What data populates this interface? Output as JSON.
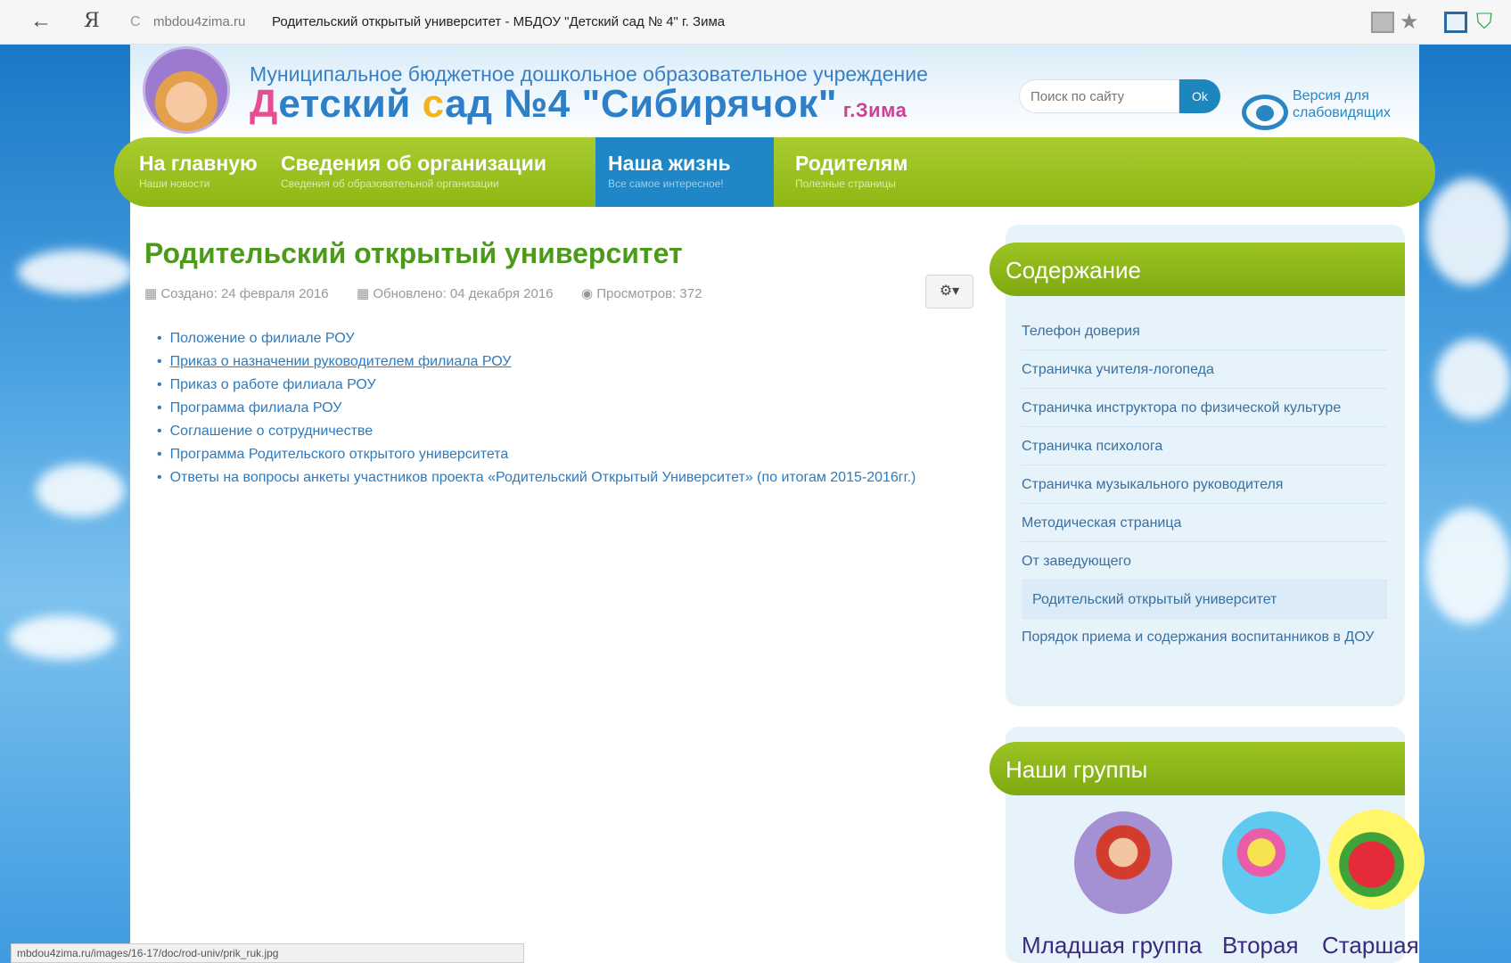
{
  "browser": {
    "back_icon": "←",
    "yandex_logo": "Я",
    "reload_icon": "C",
    "domain": "mbdou4zima.ru",
    "page_title": "Родительский открытый университет - МБДОУ \"Детский сад № 4\" г. Зима",
    "status_url": "mbdou4zima.ru/images/16-17/doc/rod-univ/prik_ruk.jpg"
  },
  "header": {
    "org_subtitle": "Муниципальное бюджетное дошкольное образовательное учреждение",
    "org_name_d": "Д",
    "org_name_1": "етский ",
    "org_name_s": "с",
    "org_name_2": "ад №4 \"Сибирячок\"",
    "org_city": " г.Зима",
    "search_placeholder": "Поиск по сайту",
    "search_button": "Ok",
    "low_vision": "Версия для слабовидящих"
  },
  "nav": [
    {
      "title": "На главную",
      "subtitle": "Наши новости"
    },
    {
      "title": "Сведения об организации",
      "subtitle": "Сведения об образовательной организации"
    },
    {
      "title": "Наша жизнь",
      "subtitle": "Все самое интересное!"
    },
    {
      "title": "Родителям",
      "subtitle": "Полезные страницы"
    }
  ],
  "article": {
    "title": "Родительский открытый университет",
    "created": "Создано: 24 февраля 2016",
    "updated": "Обновлено: 04 декабря 2016",
    "views": "Просмотров: 372",
    "gear": "⚙▾",
    "links": [
      "Положение о филиале РОУ",
      "Приказ о назначении руководителем филиала РОУ",
      "Приказ о работе филиала РОУ",
      "Программа филиала РОУ",
      "Соглашение о сотрудничестве",
      "Программа Родительского открытого университета",
      "Ответы на вопросы анкеты участников проекта «Родительский Открытый Университет» (по итогам 2015-2016гг.)"
    ]
  },
  "sidebar": {
    "contents_heading": "Содержание",
    "contents": [
      "Телефон доверия",
      "Страничка учителя-логопеда",
      "Страничка инструктора по физической культуре",
      "Страничка психолога",
      "Страничка музыкального руководителя",
      "Методическая страница",
      "От заведующего",
      "Родительский открытый университет",
      "Порядок приема и содержания воспитанников в ДОУ"
    ],
    "groups_heading": "Наши группы",
    "groups": [
      "Младшая группа",
      "Вторая",
      "Старшая"
    ]
  }
}
